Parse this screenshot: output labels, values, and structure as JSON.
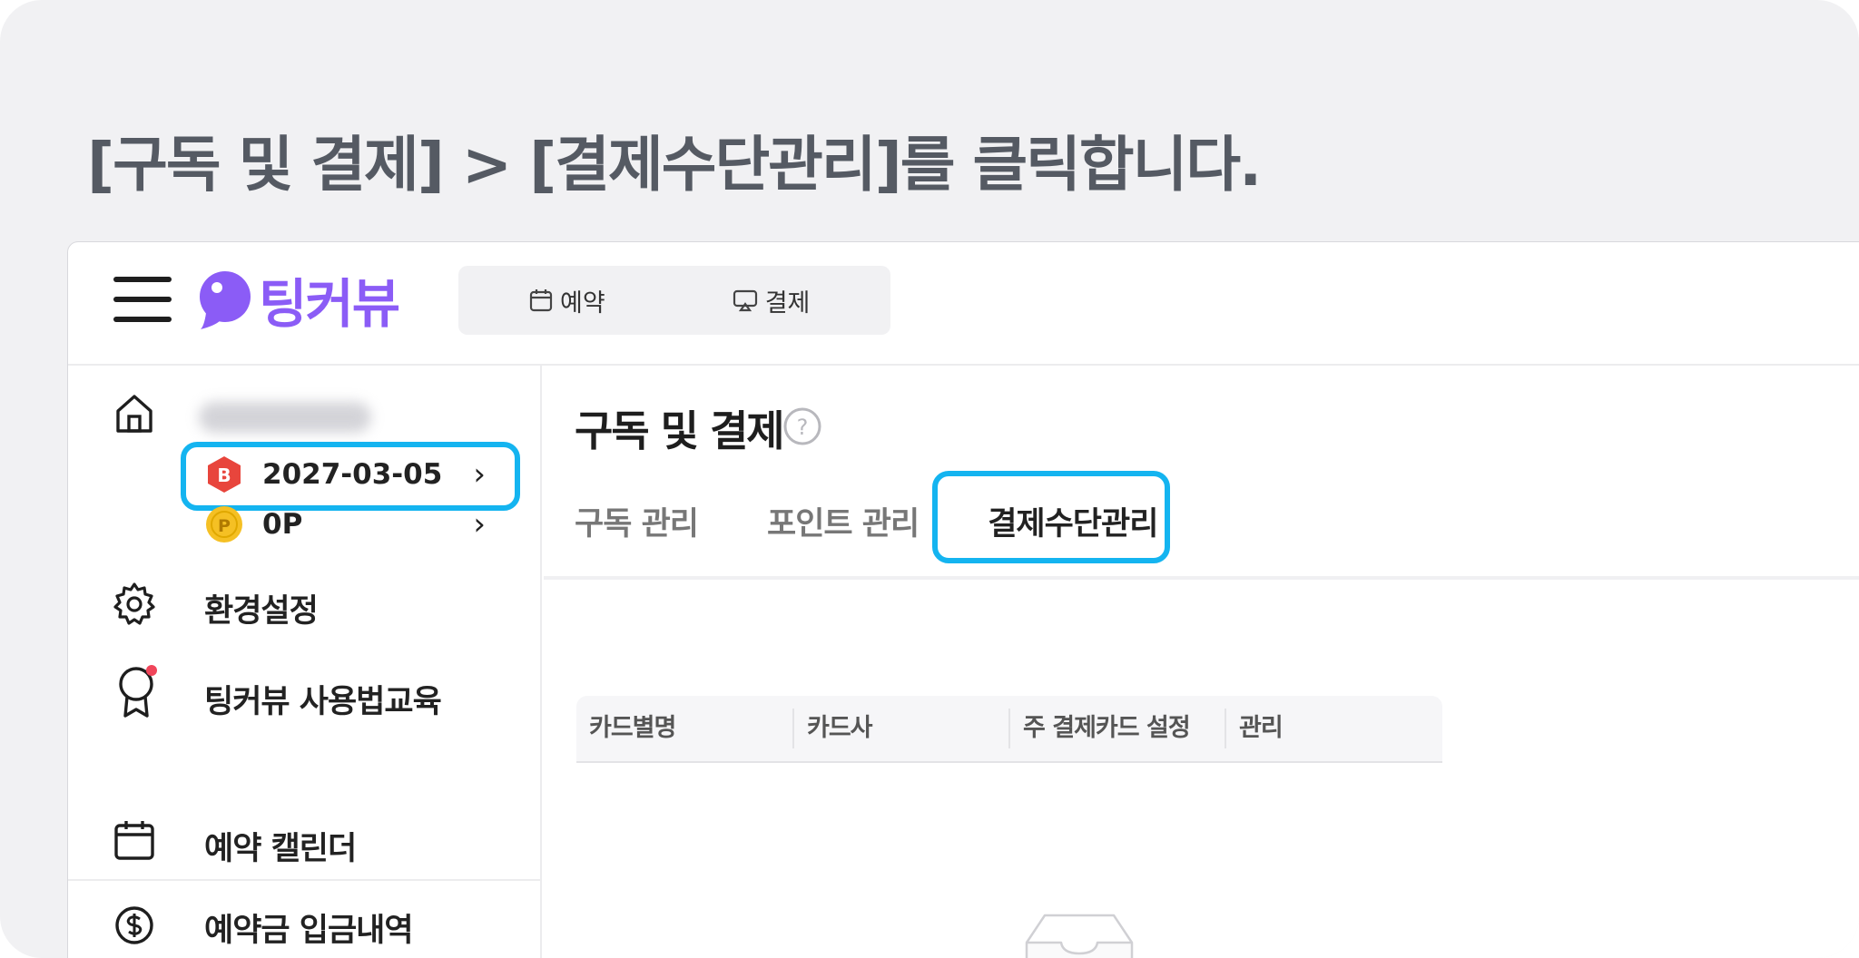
{
  "instruction": "[구독 및 결제] > [결제수단관리]를 클릭합니다.",
  "header": {
    "logo_text": "팅커뷰",
    "nav": [
      {
        "label": "예약",
        "icon": "calendar-icon"
      },
      {
        "label": "결제",
        "icon": "payment-screen-icon"
      }
    ]
  },
  "sidebar": {
    "membership_badge": "B",
    "membership_date": "2027-03-05",
    "point_badge": "P",
    "points": "0P",
    "items": [
      {
        "label": "환경설정",
        "icon": "gear-icon"
      },
      {
        "label": "팅커뷰 사용법교육",
        "icon": "award-icon"
      },
      {
        "label": "예약 캘린더",
        "icon": "calendar-icon"
      },
      {
        "label": "예약금 입금내역",
        "icon": "dollar-coin-icon"
      }
    ]
  },
  "main": {
    "title": "구독 및 결제",
    "help_symbol": "?",
    "tabs": [
      {
        "label": "구독 관리"
      },
      {
        "label": "포인트 관리"
      },
      {
        "label": "결제수단관리",
        "active": true
      }
    ],
    "table_headers": [
      "카드별명",
      "카드사",
      "주 결제카드 설정",
      "관리"
    ]
  },
  "colors": {
    "brand": "#8b5cf6",
    "highlight": "#14b4f0",
    "badge_red": "#e8453c",
    "badge_yellow": "#f5c024"
  }
}
